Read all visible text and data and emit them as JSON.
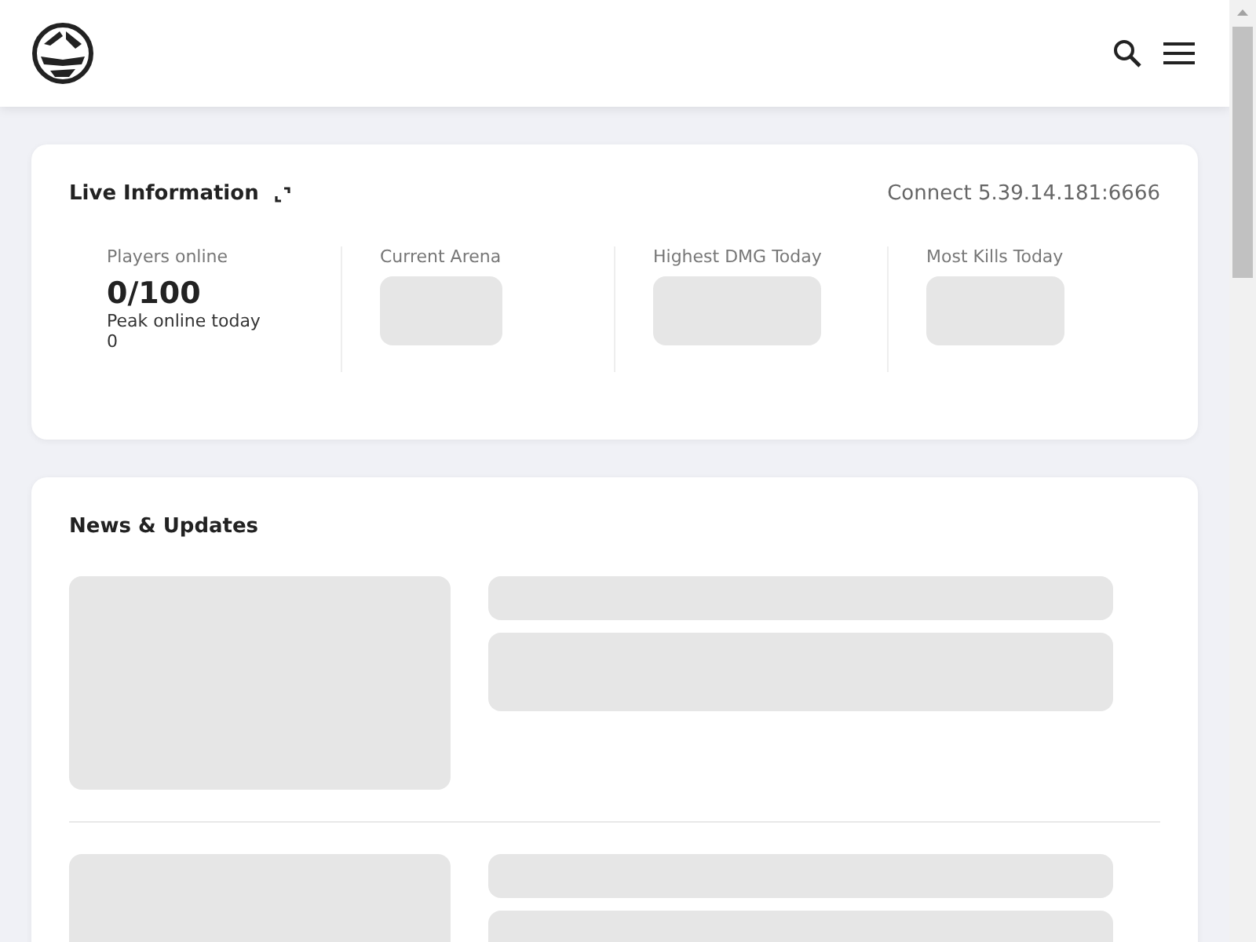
{
  "live": {
    "title": "Live Information",
    "connect": "Connect 5.39.14.181:6666",
    "stats": [
      {
        "kind": "value",
        "label": "Players online",
        "value": "0/100",
        "sub_label": "Peak online today",
        "sub_value": "0"
      },
      {
        "kind": "loading",
        "label": "Current Arena"
      },
      {
        "kind": "loading",
        "label": "Highest DMG Today"
      },
      {
        "kind": "loading",
        "label": "Most Kills Today"
      }
    ]
  },
  "news": {
    "title": "News & Updates",
    "items": [
      {
        "kind": "loading"
      },
      {
        "kind": "loading"
      }
    ]
  }
}
